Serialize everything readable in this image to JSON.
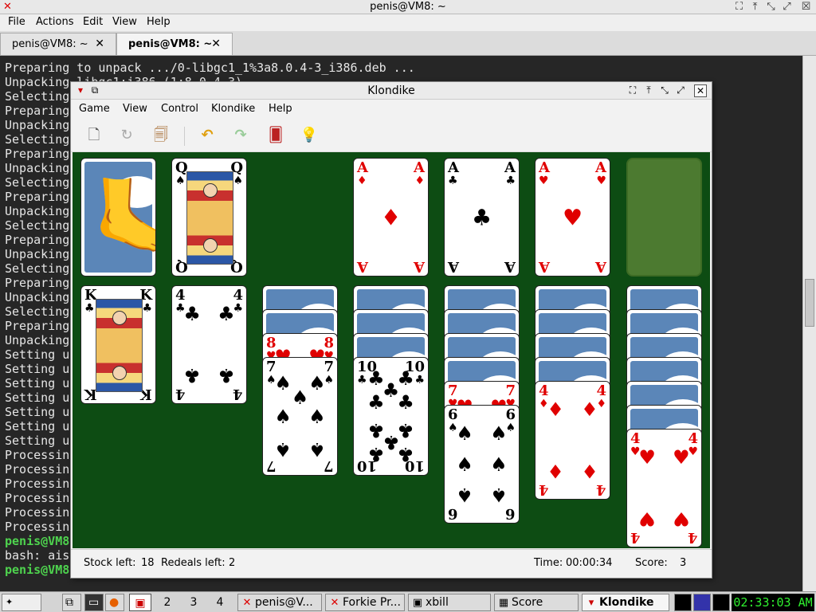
{
  "terminal": {
    "title": "penis@VM8: ~",
    "menu": [
      "File",
      "Actions",
      "Edit",
      "View",
      "Help"
    ],
    "tabs": [
      {
        "label": "penis@VM8: ~",
        "active": false
      },
      {
        "label": "penis@VM8: ~",
        "active": true
      }
    ],
    "lines": [
      "Preparing to unpack .../0-libgc1_1%3a8.0.4-3_i386.deb ...",
      "Unpacking libgc1:i386 (1:8.0.4-3) ...",
      "Selecting",
      "Preparing",
      "Unpacking",
      "Selecting",
      "Preparing",
      "Unpacking",
      "Selecting",
      "Preparing",
      "Unpacking",
      "Selecting",
      "Preparing",
      "Unpacking",
      "Selecting",
      "Preparing",
      "Unpacking",
      "Selecting",
      "Preparing",
      "Unpacking",
      "Setting u",
      "Setting u",
      "Setting u",
      "Setting u",
      "Setting u",
      "Setting u",
      "Setting u",
      "Processin",
      "Processin",
      "Processin",
      "Processin",
      "Processin",
      "Processin"
    ],
    "prompt_lines": [
      "penis@VM8",
      "bash: ais",
      "penis@VM8"
    ]
  },
  "klondike": {
    "title": "Klondike",
    "menu": [
      "Game",
      "View",
      "Control",
      "Klondike",
      "Help"
    ],
    "toolbar_icons": [
      "new-game-icon",
      "restart-icon",
      "select-game-icon",
      "undo-icon",
      "redo-icon",
      "deal-icon",
      "hint-icon"
    ],
    "toolbar_glyphs": [
      "🗋",
      "↻",
      "🗐",
      "↶",
      "↷",
      "🂠",
      "💡"
    ],
    "status": {
      "stock_label": "Stock left:",
      "stock_value": "18",
      "redeals_label": "Redeals left:",
      "redeals_value": "2",
      "time_label": "Time:",
      "time_value": "00:00:34",
      "score_label": "Score:",
      "score_value": "3"
    },
    "stock_logo": "🦶",
    "waste": {
      "rank": "Q",
      "suit": "♠",
      "color": "black"
    },
    "foundations": [
      {
        "rank": "A",
        "suit": "♦",
        "color": "red"
      },
      {
        "rank": "A",
        "suit": "♣",
        "color": "black"
      },
      {
        "rank": "A",
        "suit": "♥",
        "color": "red"
      },
      null
    ],
    "tableau": [
      {
        "hidden": 0,
        "cards": [
          {
            "rank": "K",
            "suit": "♣",
            "color": "black"
          }
        ]
      },
      {
        "hidden": 0,
        "cards": [
          {
            "rank": "4",
            "suit": "♣",
            "color": "black"
          }
        ]
      },
      {
        "hidden": 2,
        "cards": [
          {
            "rank": "8",
            "suit": "♥",
            "color": "red"
          },
          {
            "rank": "7",
            "suit": "♠",
            "color": "black"
          }
        ]
      },
      {
        "hidden": 3,
        "cards": [
          {
            "rank": "10",
            "suit": "♣",
            "color": "black"
          }
        ]
      },
      {
        "hidden": 4,
        "cards": [
          {
            "rank": "7",
            "suit": "♥",
            "color": "red"
          },
          {
            "rank": "6",
            "suit": "♠",
            "color": "black"
          }
        ]
      },
      {
        "hidden": 4,
        "cards": [
          {
            "rank": "4",
            "suit": "♦",
            "color": "red"
          }
        ]
      },
      {
        "hidden": 6,
        "cards": [
          {
            "rank": "4",
            "suit": "♥",
            "color": "red"
          }
        ]
      }
    ]
  },
  "taskbar": {
    "workspaces": [
      "2",
      "3",
      "4"
    ],
    "tasks": [
      {
        "label": "penis@V...",
        "icon": "x-icon",
        "glyph": "✕",
        "active": false
      },
      {
        "label": "Forkie Pr...",
        "icon": "x-icon",
        "glyph": "✕",
        "active": false
      },
      {
        "label": "xbill",
        "icon": "xbill-icon",
        "glyph": "▣",
        "active": false
      },
      {
        "label": "Score",
        "icon": "score-icon",
        "glyph": "▦",
        "active": false
      },
      {
        "label": "Klondike",
        "icon": "klondike-icon",
        "glyph": "▾",
        "active": true
      }
    ],
    "clock": "02:33:03 AM"
  }
}
